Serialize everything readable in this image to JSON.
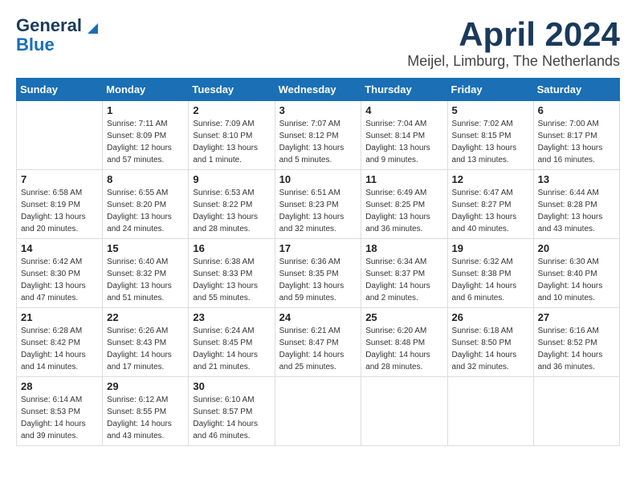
{
  "header": {
    "logo_line1": "General",
    "logo_line2": "Blue",
    "month_title": "April 2024",
    "location": "Meijel, Limburg, The Netherlands"
  },
  "weekdays": [
    "Sunday",
    "Monday",
    "Tuesday",
    "Wednesday",
    "Thursday",
    "Friday",
    "Saturday"
  ],
  "weeks": [
    [
      {
        "day": "",
        "sunrise": "",
        "sunset": "",
        "daylight": ""
      },
      {
        "day": "1",
        "sunrise": "Sunrise: 7:11 AM",
        "sunset": "Sunset: 8:09 PM",
        "daylight": "Daylight: 12 hours and 57 minutes."
      },
      {
        "day": "2",
        "sunrise": "Sunrise: 7:09 AM",
        "sunset": "Sunset: 8:10 PM",
        "daylight": "Daylight: 13 hours and 1 minute."
      },
      {
        "day": "3",
        "sunrise": "Sunrise: 7:07 AM",
        "sunset": "Sunset: 8:12 PM",
        "daylight": "Daylight: 13 hours and 5 minutes."
      },
      {
        "day": "4",
        "sunrise": "Sunrise: 7:04 AM",
        "sunset": "Sunset: 8:14 PM",
        "daylight": "Daylight: 13 hours and 9 minutes."
      },
      {
        "day": "5",
        "sunrise": "Sunrise: 7:02 AM",
        "sunset": "Sunset: 8:15 PM",
        "daylight": "Daylight: 13 hours and 13 minutes."
      },
      {
        "day": "6",
        "sunrise": "Sunrise: 7:00 AM",
        "sunset": "Sunset: 8:17 PM",
        "daylight": "Daylight: 13 hours and 16 minutes."
      }
    ],
    [
      {
        "day": "7",
        "sunrise": "Sunrise: 6:58 AM",
        "sunset": "Sunset: 8:19 PM",
        "daylight": "Daylight: 13 hours and 20 minutes."
      },
      {
        "day": "8",
        "sunrise": "Sunrise: 6:55 AM",
        "sunset": "Sunset: 8:20 PM",
        "daylight": "Daylight: 13 hours and 24 minutes."
      },
      {
        "day": "9",
        "sunrise": "Sunrise: 6:53 AM",
        "sunset": "Sunset: 8:22 PM",
        "daylight": "Daylight: 13 hours and 28 minutes."
      },
      {
        "day": "10",
        "sunrise": "Sunrise: 6:51 AM",
        "sunset": "Sunset: 8:23 PM",
        "daylight": "Daylight: 13 hours and 32 minutes."
      },
      {
        "day": "11",
        "sunrise": "Sunrise: 6:49 AM",
        "sunset": "Sunset: 8:25 PM",
        "daylight": "Daylight: 13 hours and 36 minutes."
      },
      {
        "day": "12",
        "sunrise": "Sunrise: 6:47 AM",
        "sunset": "Sunset: 8:27 PM",
        "daylight": "Daylight: 13 hours and 40 minutes."
      },
      {
        "day": "13",
        "sunrise": "Sunrise: 6:44 AM",
        "sunset": "Sunset: 8:28 PM",
        "daylight": "Daylight: 13 hours and 43 minutes."
      }
    ],
    [
      {
        "day": "14",
        "sunrise": "Sunrise: 6:42 AM",
        "sunset": "Sunset: 8:30 PM",
        "daylight": "Daylight: 13 hours and 47 minutes."
      },
      {
        "day": "15",
        "sunrise": "Sunrise: 6:40 AM",
        "sunset": "Sunset: 8:32 PM",
        "daylight": "Daylight: 13 hours and 51 minutes."
      },
      {
        "day": "16",
        "sunrise": "Sunrise: 6:38 AM",
        "sunset": "Sunset: 8:33 PM",
        "daylight": "Daylight: 13 hours and 55 minutes."
      },
      {
        "day": "17",
        "sunrise": "Sunrise: 6:36 AM",
        "sunset": "Sunset: 8:35 PM",
        "daylight": "Daylight: 13 hours and 59 minutes."
      },
      {
        "day": "18",
        "sunrise": "Sunrise: 6:34 AM",
        "sunset": "Sunset: 8:37 PM",
        "daylight": "Daylight: 14 hours and 2 minutes."
      },
      {
        "day": "19",
        "sunrise": "Sunrise: 6:32 AM",
        "sunset": "Sunset: 8:38 PM",
        "daylight": "Daylight: 14 hours and 6 minutes."
      },
      {
        "day": "20",
        "sunrise": "Sunrise: 6:30 AM",
        "sunset": "Sunset: 8:40 PM",
        "daylight": "Daylight: 14 hours and 10 minutes."
      }
    ],
    [
      {
        "day": "21",
        "sunrise": "Sunrise: 6:28 AM",
        "sunset": "Sunset: 8:42 PM",
        "daylight": "Daylight: 14 hours and 14 minutes."
      },
      {
        "day": "22",
        "sunrise": "Sunrise: 6:26 AM",
        "sunset": "Sunset: 8:43 PM",
        "daylight": "Daylight: 14 hours and 17 minutes."
      },
      {
        "day": "23",
        "sunrise": "Sunrise: 6:24 AM",
        "sunset": "Sunset: 8:45 PM",
        "daylight": "Daylight: 14 hours and 21 minutes."
      },
      {
        "day": "24",
        "sunrise": "Sunrise: 6:21 AM",
        "sunset": "Sunset: 8:47 PM",
        "daylight": "Daylight: 14 hours and 25 minutes."
      },
      {
        "day": "25",
        "sunrise": "Sunrise: 6:20 AM",
        "sunset": "Sunset: 8:48 PM",
        "daylight": "Daylight: 14 hours and 28 minutes."
      },
      {
        "day": "26",
        "sunrise": "Sunrise: 6:18 AM",
        "sunset": "Sunset: 8:50 PM",
        "daylight": "Daylight: 14 hours and 32 minutes."
      },
      {
        "day": "27",
        "sunrise": "Sunrise: 6:16 AM",
        "sunset": "Sunset: 8:52 PM",
        "daylight": "Daylight: 14 hours and 36 minutes."
      }
    ],
    [
      {
        "day": "28",
        "sunrise": "Sunrise: 6:14 AM",
        "sunset": "Sunset: 8:53 PM",
        "daylight": "Daylight: 14 hours and 39 minutes."
      },
      {
        "day": "29",
        "sunrise": "Sunrise: 6:12 AM",
        "sunset": "Sunset: 8:55 PM",
        "daylight": "Daylight: 14 hours and 43 minutes."
      },
      {
        "day": "30",
        "sunrise": "Sunrise: 6:10 AM",
        "sunset": "Sunset: 8:57 PM",
        "daylight": "Daylight: 14 hours and 46 minutes."
      },
      {
        "day": "",
        "sunrise": "",
        "sunset": "",
        "daylight": ""
      },
      {
        "day": "",
        "sunrise": "",
        "sunset": "",
        "daylight": ""
      },
      {
        "day": "",
        "sunrise": "",
        "sunset": "",
        "daylight": ""
      },
      {
        "day": "",
        "sunrise": "",
        "sunset": "",
        "daylight": ""
      }
    ]
  ]
}
